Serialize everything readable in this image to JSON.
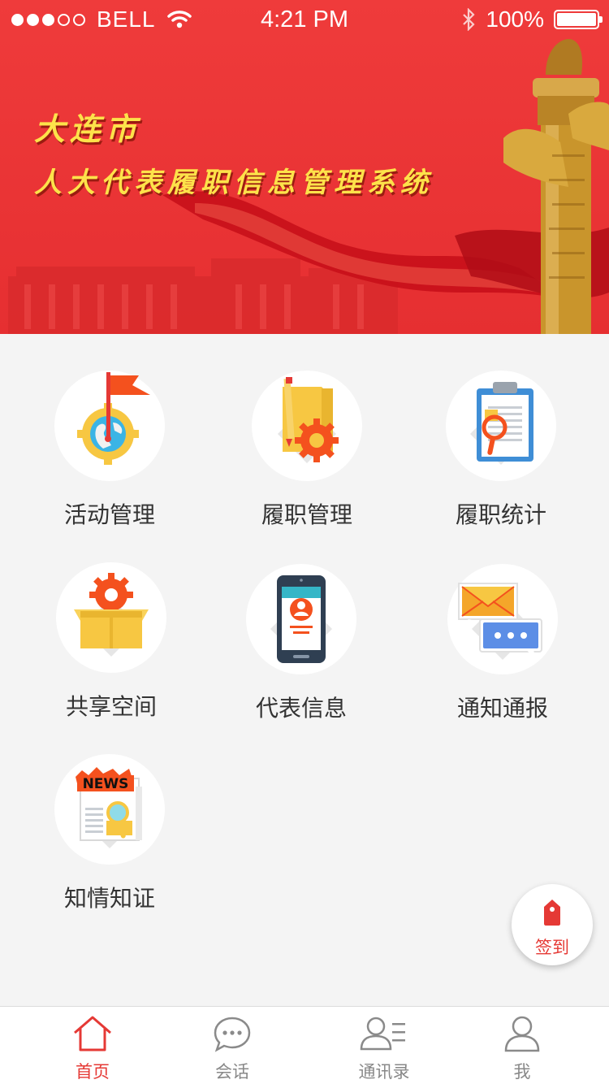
{
  "status_bar": {
    "carrier": "BELL",
    "time": "4:21 PM",
    "battery": "100%"
  },
  "banner": {
    "title_line1": "大连市",
    "title_line2": "人大代表履职信息管理系统"
  },
  "menu": {
    "items": [
      {
        "label": "活动管理",
        "icon": "flag-globe-gear-icon"
      },
      {
        "label": "履职管理",
        "icon": "folder-gear-icon"
      },
      {
        "label": "履职统计",
        "icon": "clipboard-magnifier-icon"
      },
      {
        "label": "共享空间",
        "icon": "box-gear-icon"
      },
      {
        "label": "代表信息",
        "icon": "phone-profile-icon"
      },
      {
        "label": "通知通报",
        "icon": "envelope-chat-icon"
      },
      {
        "label": "知情知证",
        "icon": "news-magnifier-icon"
      }
    ]
  },
  "news_badge": "NEWS",
  "checkin": {
    "label": "签到",
    "icon": "tag-icon"
  },
  "tabbar": {
    "items": [
      {
        "label": "首页",
        "icon": "home-icon",
        "active": true
      },
      {
        "label": "会话",
        "icon": "chat-bubble-icon",
        "active": false
      },
      {
        "label": "通讯录",
        "icon": "contacts-icon",
        "active": false
      },
      {
        "label": "我",
        "icon": "user-icon",
        "active": false
      }
    ]
  },
  "colors": {
    "brand_red": "#e53935",
    "banner_red": "#ec3437",
    "title_gold": "#fde24a",
    "background": "#f4f4f4"
  }
}
